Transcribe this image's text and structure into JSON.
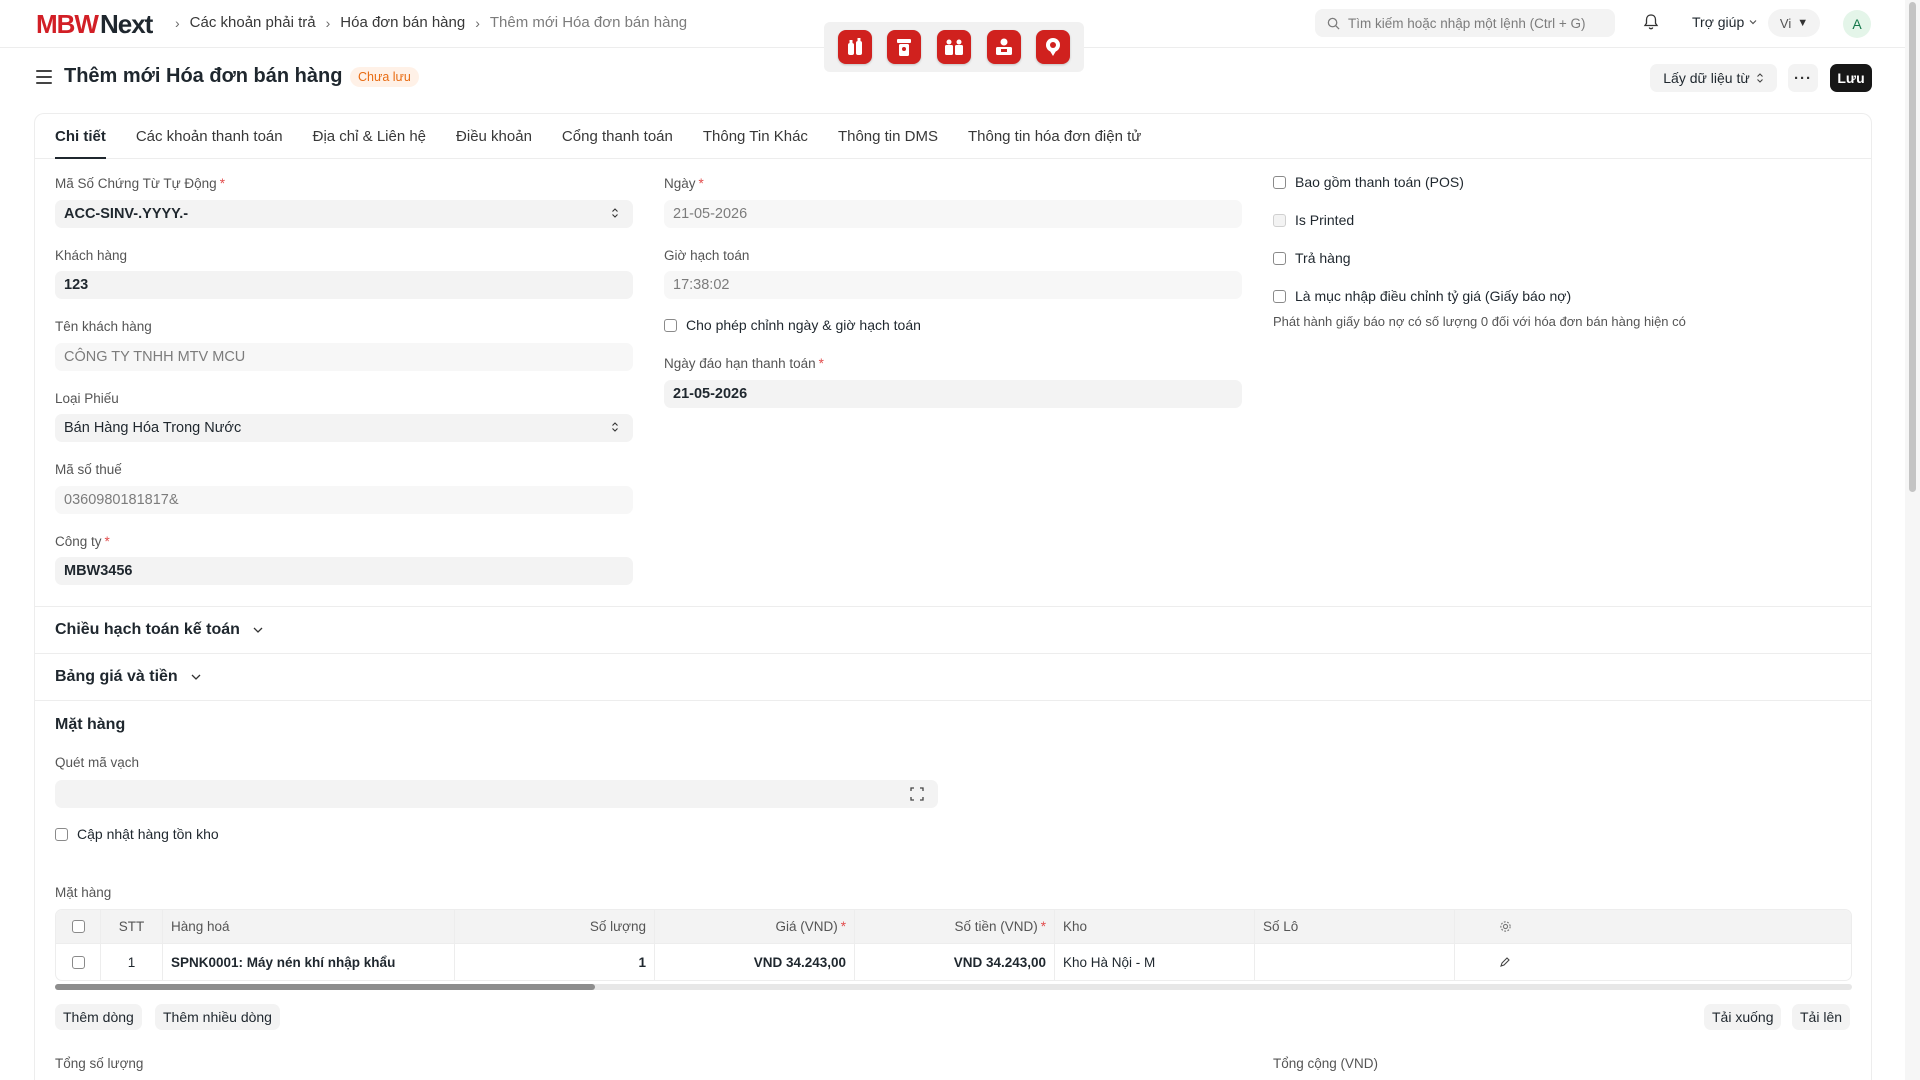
{
  "navbar": {
    "logo_brand": "MBW",
    "logo_product": "Next",
    "breadcrumbs": [
      "Các khoản phải trả",
      "Hóa đơn bán hàng",
      "Thêm mới Hóa đơn bán hàng"
    ],
    "search_placeholder": "Tìm kiếm hoặc nhập một lệnh (Ctrl + G)",
    "help_label": "Trợ giúp",
    "language": "Vi",
    "avatar_initial": "A"
  },
  "app_dock": [
    "bottles-app-icon",
    "drinks-app-icon",
    "boxes-app-icon",
    "shop-app-icon",
    "location-app-icon"
  ],
  "page": {
    "title": "Thêm mới Hóa đơn bán hàng",
    "status_badge": "Chưa lưu",
    "fetch_button": "Lấy dữ liệu từ",
    "more_button": "···",
    "save_button": "Lưu"
  },
  "tabs": [
    "Chi tiết",
    "Các khoản thanh toán",
    "Địa chỉ & Liên hệ",
    "Điều khoản",
    "Cổng thanh toán",
    "Thông Tin Khác",
    "Thông tin DMS",
    "Thông tin hóa đơn điện tử"
  ],
  "form": {
    "naming_series": {
      "label": "Mã Số Chứng Từ Tự Động",
      "value": "ACC-SINV-.YYYY.-"
    },
    "customer": {
      "label": "Khách hàng",
      "value": "123"
    },
    "customer_name": {
      "label": "Tên khách hàng",
      "value": "CÔNG TY TNHH MTV MCU"
    },
    "voucher_type": {
      "label": "Loại Phiếu",
      "value": "Bán Hàng Hóa Trong Nước"
    },
    "tax_id": {
      "label": "Mã số thuế",
      "value": "0360980181817&"
    },
    "company": {
      "label": "Công ty",
      "value": "MBW3456"
    },
    "posting_date": {
      "label": "Ngày",
      "value": "21-05-2026"
    },
    "posting_time": {
      "label": "Giờ hạch toán",
      "value": "17:38:02"
    },
    "edit_posting": {
      "label": "Cho phép chỉnh ngày & giờ hạch toán"
    },
    "due_date": {
      "label": "Ngày đáo hạn thanh toán",
      "value": "21-05-2026"
    },
    "is_pos": {
      "label": "Bao gồm thanh toán (POS)"
    },
    "is_printed": {
      "label": "Is Printed"
    },
    "is_return": {
      "label": "Trả hàng"
    },
    "is_debit_note": {
      "label": "Là mục nhập điều chỉnh tỷ giá (Giấy báo nợ)"
    },
    "debit_note_help": "Phát hành giấy báo nợ có số lượng 0 đối với hóa đơn bán hàng hiện có"
  },
  "sections": {
    "accounting_dimensions": "Chiều hạch toán kế toán",
    "price_list": "Bảng giá và tiền",
    "items": "Mặt hàng"
  },
  "items_section": {
    "barcode_label": "Quét mã vạch",
    "update_stock_label": "Cập nhật hàng tồn kho",
    "table_label": "Mặt hàng",
    "columns": [
      "STT",
      "Hàng hoá",
      "Số lượng",
      "Giá (VND)",
      "Số tiền (VND)",
      "Kho",
      "Số Lô"
    ],
    "rows": [
      {
        "idx": "1",
        "item": "SPNK0001: Máy nén khí nhập khẩu",
        "qty": "1",
        "rate": "VND 34.243,00",
        "amount": "VND 34.243,00",
        "warehouse": "Kho Hà Nội - M",
        "batch": ""
      }
    ],
    "add_row": "Thêm dòng",
    "add_multiple": "Thêm nhiều dòng",
    "download": "Tải xuống",
    "upload": "Tải lên"
  },
  "totals": {
    "total_qty_label": "Tổng số lượng",
    "total_label": "Tổng cộng (VND)"
  },
  "colors": {
    "brand_red": "#d21f26",
    "primary_button": "#171717",
    "unsaved_badge_bg": "#fff1e7",
    "unsaved_badge_text": "#e86c13"
  }
}
